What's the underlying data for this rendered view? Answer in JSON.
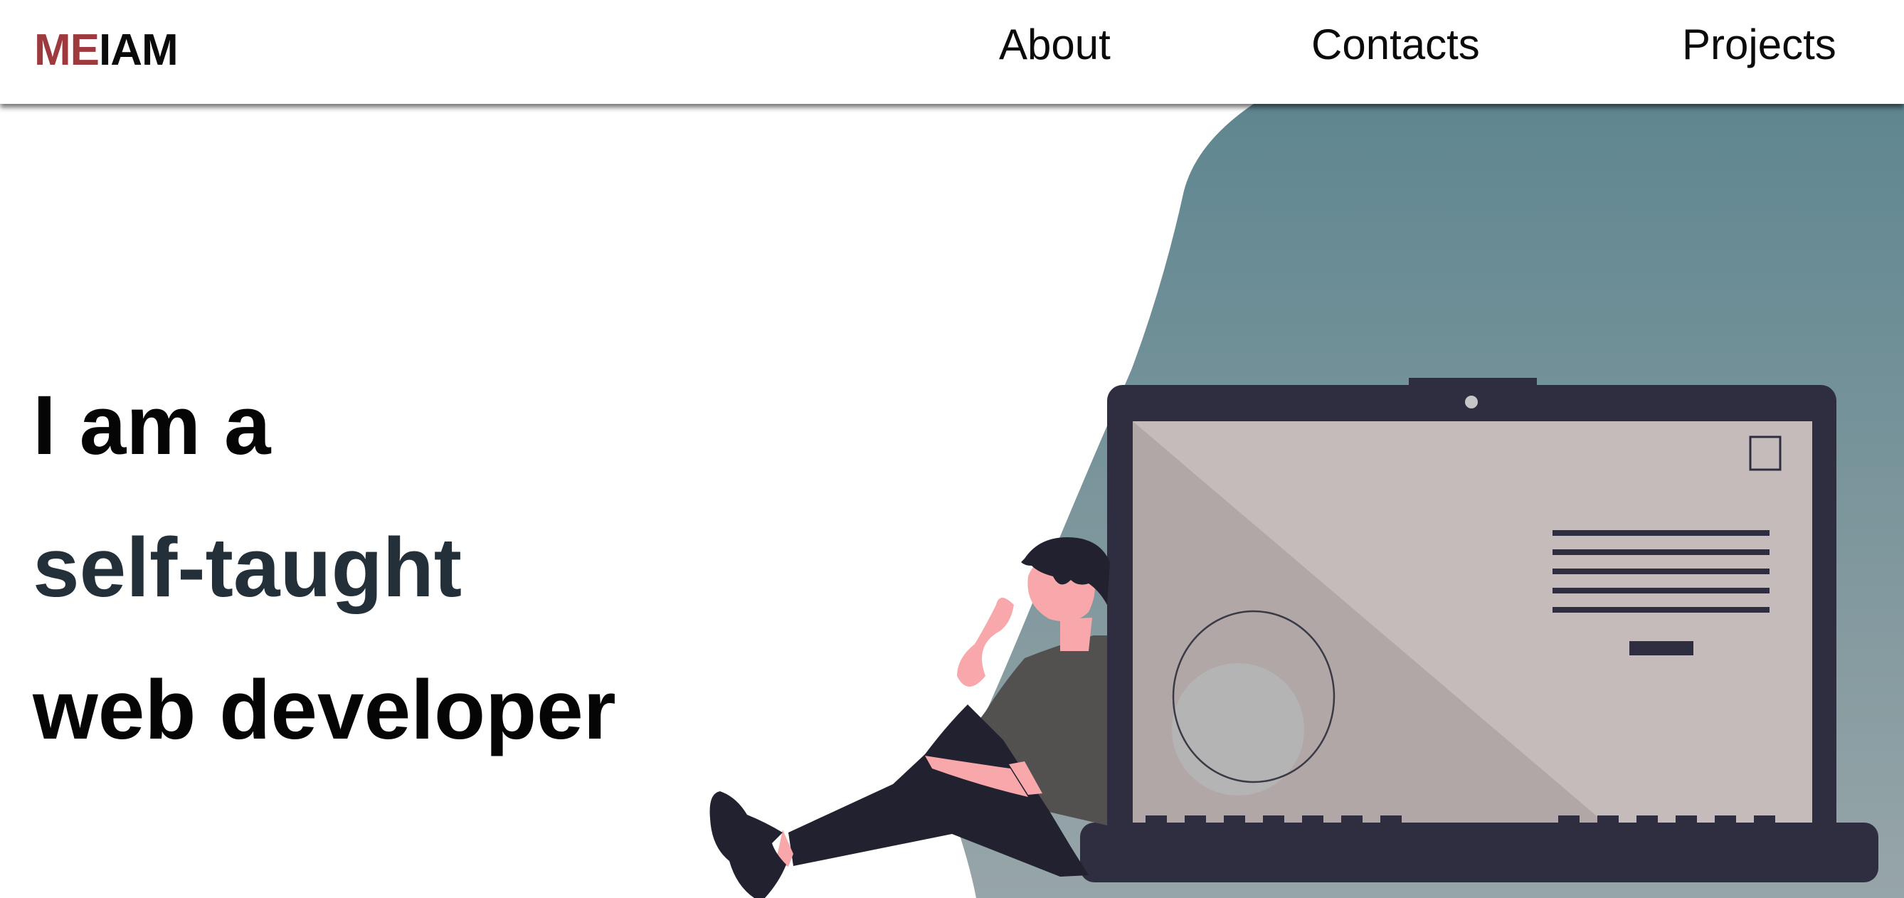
{
  "header": {
    "logo": {
      "part1": "ME",
      "part2": "IAM"
    },
    "nav": [
      {
        "label": "About"
      },
      {
        "label": "Contacts"
      },
      {
        "label": "Projects"
      }
    ]
  },
  "hero": {
    "line1": "I am a",
    "line2": "self-taught",
    "line3": "web developer"
  },
  "colors": {
    "logo_accent": "#9e3a3e",
    "heading_accent": "#243039",
    "blob_top": "#5f8690",
    "blob_bottom": "#97a5a8",
    "laptop_frame": "#2f2e41",
    "screen": "#c6bbbb",
    "skin": "#f8a8ab"
  },
  "illustration": {
    "icon": "person-leaning-on-laptop-illustration"
  }
}
